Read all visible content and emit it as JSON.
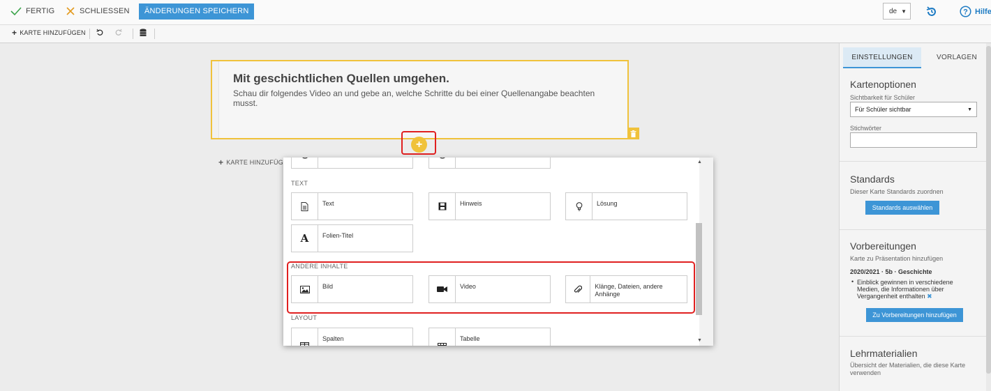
{
  "topbar": {
    "done_label": "FERTIG",
    "close_label": "SCHLIESSEN",
    "save_label": "ÄNDERUNGEN SPEICHERN",
    "language": "de",
    "help_label": "Hilfe"
  },
  "toolbar": {
    "add_card_label": "KARTE HINZUFÜGEN"
  },
  "card": {
    "title": "Mit geschichtlichen Quellen umgehen.",
    "text": "Schau dir folgendes Video an und gebe an, welche Schritte du bei einer Quellenangabe beachten musst."
  },
  "canvas": {
    "add_card_label": "KARTE HINZUFÜGEN"
  },
  "popup": {
    "sections": {
      "text": "TEXT",
      "other": "ANDERE INHALTE",
      "layout": "LAYOUT"
    },
    "tiles": {
      "text": "Text",
      "hint": "Hinweis",
      "solution": "Lösung",
      "slide_title": "Folien-Titel",
      "image": "Bild",
      "video": "Video",
      "sounds": "Klänge, Dateien, andere Anhänge",
      "columns": "Spalten",
      "table": "Tabelle"
    }
  },
  "panel": {
    "tabs": [
      "EINSTELLUNGEN",
      "VORLAGEN"
    ],
    "card_options": {
      "heading": "Kartenoptionen",
      "visibility_label": "Sichtbarkeit für Schüler",
      "visibility_value": "Für Schüler sichtbar",
      "keywords_label": "Stichwörter"
    },
    "standards": {
      "heading": "Standards",
      "desc": "Dieser Karte Standards zuordnen",
      "button": "Standards auswählen"
    },
    "preparations": {
      "heading": "Vorbereitungen",
      "desc": "Karte zu Präsentation hinzufügen",
      "course": "2020/2021 · 5b · Geschichte",
      "item": "Einblick gewinnen in verschiedene Medien, die Informationen über Vergangenheit enthalten",
      "button": "Zu Vorbereitungen hinzufügen"
    },
    "materials": {
      "heading": "Lehrmaterialien",
      "desc": "Übersicht der Materialien, die diese Karte verwenden"
    }
  },
  "colors": {
    "accent": "#3d95d6",
    "card_border": "#f0c23b",
    "highlight": "#e02020"
  }
}
